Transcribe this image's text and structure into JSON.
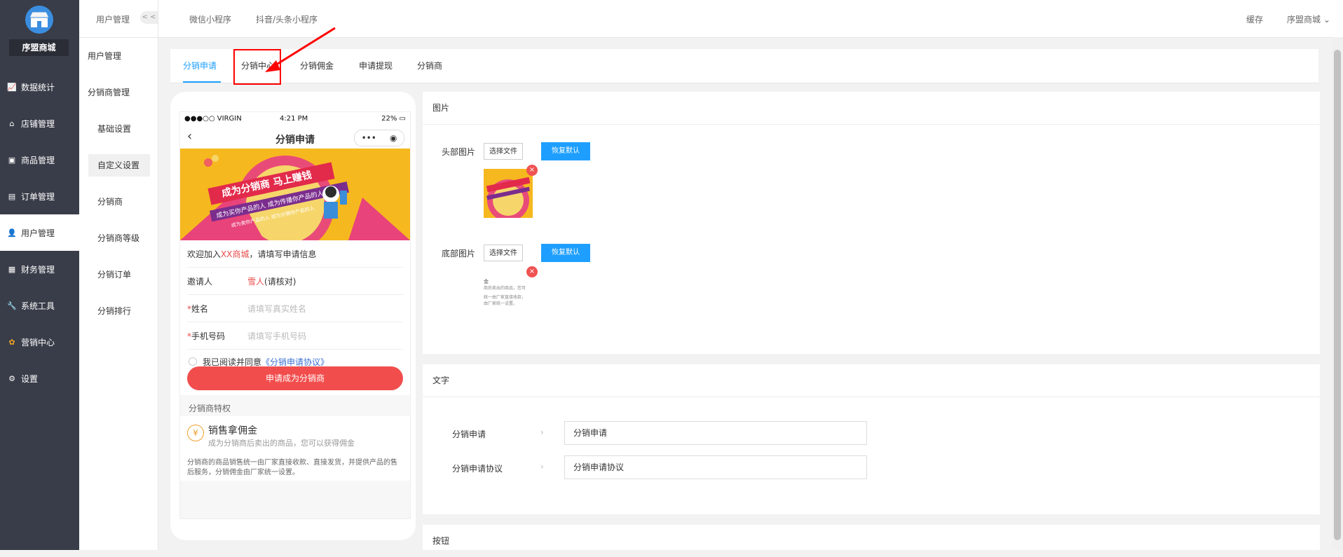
{
  "sidebar": {
    "store": "序盟商城",
    "items": [
      {
        "label": "数据统计",
        "icon": "chart-icon"
      },
      {
        "label": "店铺管理",
        "icon": "store-icon"
      },
      {
        "label": "商品管理",
        "icon": "product-icon"
      },
      {
        "label": "订单管理",
        "icon": "order-icon"
      },
      {
        "label": "用户管理",
        "icon": "user-icon"
      },
      {
        "label": "财务管理",
        "icon": "finance-icon"
      },
      {
        "label": "系统工具",
        "icon": "wrench-icon"
      },
      {
        "label": "营销中心",
        "icon": "marketing-icon"
      },
      {
        "label": "设置",
        "icon": "settings-icon"
      }
    ]
  },
  "subsidebar": {
    "header": "用户管理",
    "collapse": "< <",
    "groups": [
      "用户管理",
      "分销商管理"
    ],
    "items": [
      "基础设置",
      "自定义设置",
      "分销商",
      "分销商等级",
      "分销订单",
      "分销排行"
    ]
  },
  "topbar": {
    "tabs": [
      "微信小程序",
      "抖音/头条小程序"
    ],
    "cache": "缓存",
    "account": "序盟商城"
  },
  "tabs": [
    "分销申请",
    "分销中心",
    "分销佣金",
    "申请提现",
    "分销商"
  ],
  "phone": {
    "status_left": "●●●○○ VIRGIN",
    "status_time": "4:21 PM",
    "status_right": "22%",
    "title": "分销申请",
    "banner_title": "成为分销商 马上赚钱",
    "banner_line1": "成为买你产品的人 成为传播你产品的人",
    "banner_line2": "成为卖你产品的人 成为分销你产品的人",
    "welcome_prefix": "欢迎加入",
    "welcome_shop": "XX商城",
    "welcome_suffix": "，请填写申请信息",
    "inviter_label": "邀请人",
    "inviter_name": "雪人",
    "inviter_note": "(请核对)",
    "name_label": "姓名",
    "name_placeholder": "请填写真实姓名",
    "phone_label": "手机号码",
    "phone_placeholder": "请填写手机号码",
    "agree_text": "我已阅读并同意",
    "agree_link": "《分销申请协议》",
    "apply_button": "申请成为分销商",
    "privilege_title": "分销商特权",
    "privilege_name": "销售拿佣金",
    "privilege_desc": "成为分销商后卖出的商品，您可以获得佣金",
    "privilege_note": "分销商的商品销售统一由厂家直接收款、直接发货，并提供产品的售后服务，分销佣金由厂家统一设置。"
  },
  "image_panel": {
    "title": "图片",
    "header_label": "头部图片",
    "footer_label": "底部图片",
    "choose_file": "选择文件",
    "restore_default": "恢复默认",
    "footer_thumb_lines": [
      "金",
      "商后卖出的商品，您可",
      "统一由厂家直接收款，",
      "由厂家统一设置。"
    ]
  },
  "text_panel": {
    "title": "文字",
    "rows": [
      {
        "label": "分销申请",
        "value": "分销申请"
      },
      {
        "label": "分销申请协议",
        "value": "分销申请协议"
      }
    ]
  },
  "button_panel": {
    "title": "按钮"
  },
  "colors": {
    "sidebar": "#393d49",
    "accent": "#1e9fff",
    "apply": "#f24d4d",
    "annotation": "#ff0000"
  }
}
